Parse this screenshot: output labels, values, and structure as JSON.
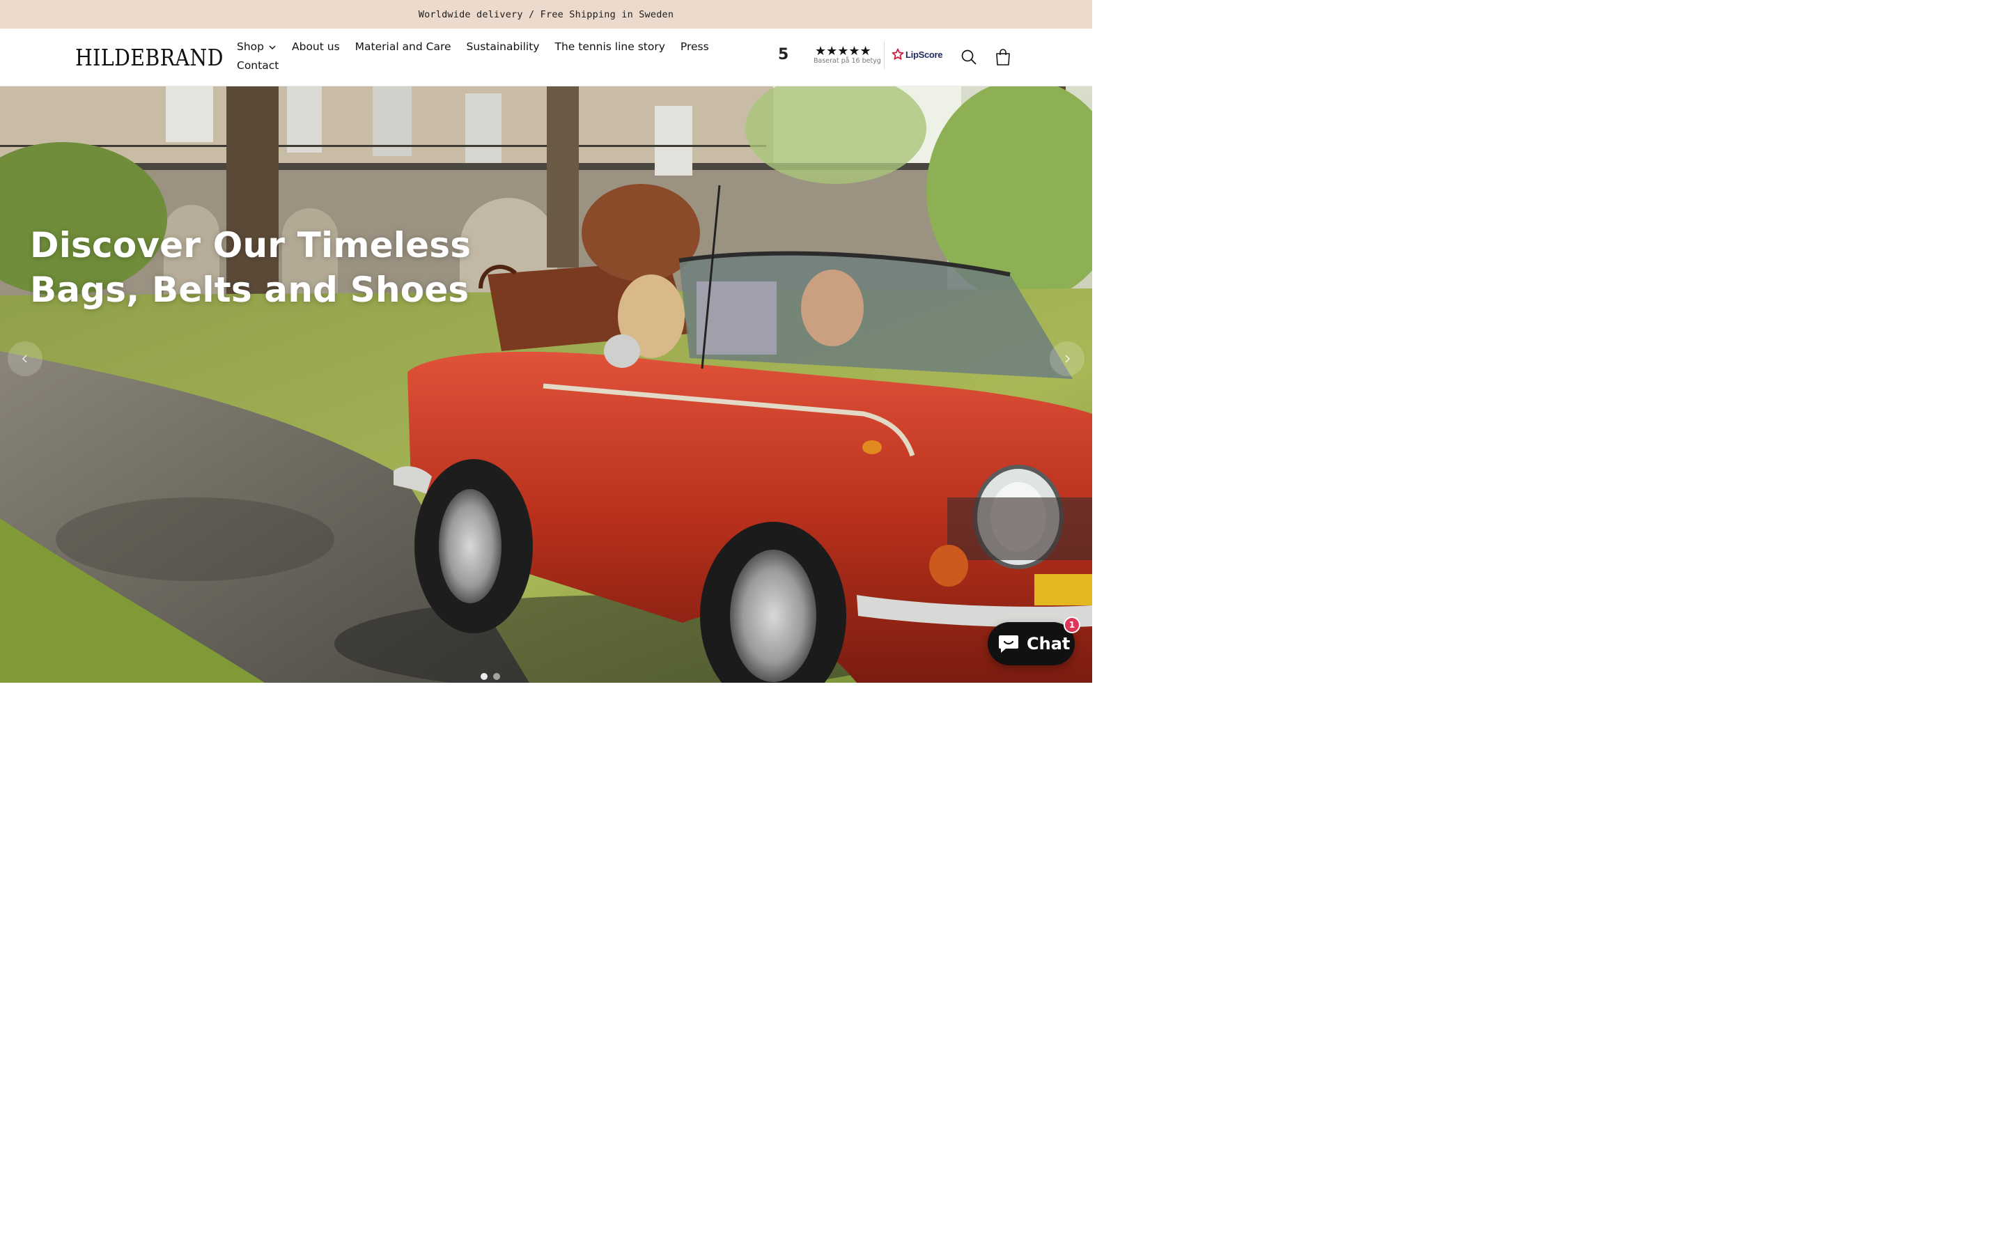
{
  "announcement": {
    "text": "Worldwide delivery / Free Shipping in Sweden"
  },
  "header": {
    "logo": "HILDEBRAND",
    "nav": [
      {
        "label": "Shop",
        "has_dropdown": true
      },
      {
        "label": "About us"
      },
      {
        "label": "Material and Care"
      },
      {
        "label": "Sustainability"
      },
      {
        "label": "The tennis line story"
      },
      {
        "label": "Press"
      },
      {
        "label": "Contact"
      }
    ],
    "rating": {
      "score": "5",
      "stars": "★★★★★",
      "subtext": "Baserat på 16 betyg",
      "provider": "LipScore"
    },
    "icons": [
      "search-icon",
      "cart-icon"
    ]
  },
  "hero": {
    "title_line1": "Discover Our Timeless",
    "title_line2": "Bags, Belts and Shoes",
    "slide_count": 2,
    "active_slide": 1
  },
  "chat": {
    "label": "Chat",
    "badge": "1"
  },
  "colors": {
    "announcement_bg": "#ecdacc",
    "car_red": "#c23a22",
    "chat_bg": "#111111",
    "badge": "#e0355b"
  }
}
